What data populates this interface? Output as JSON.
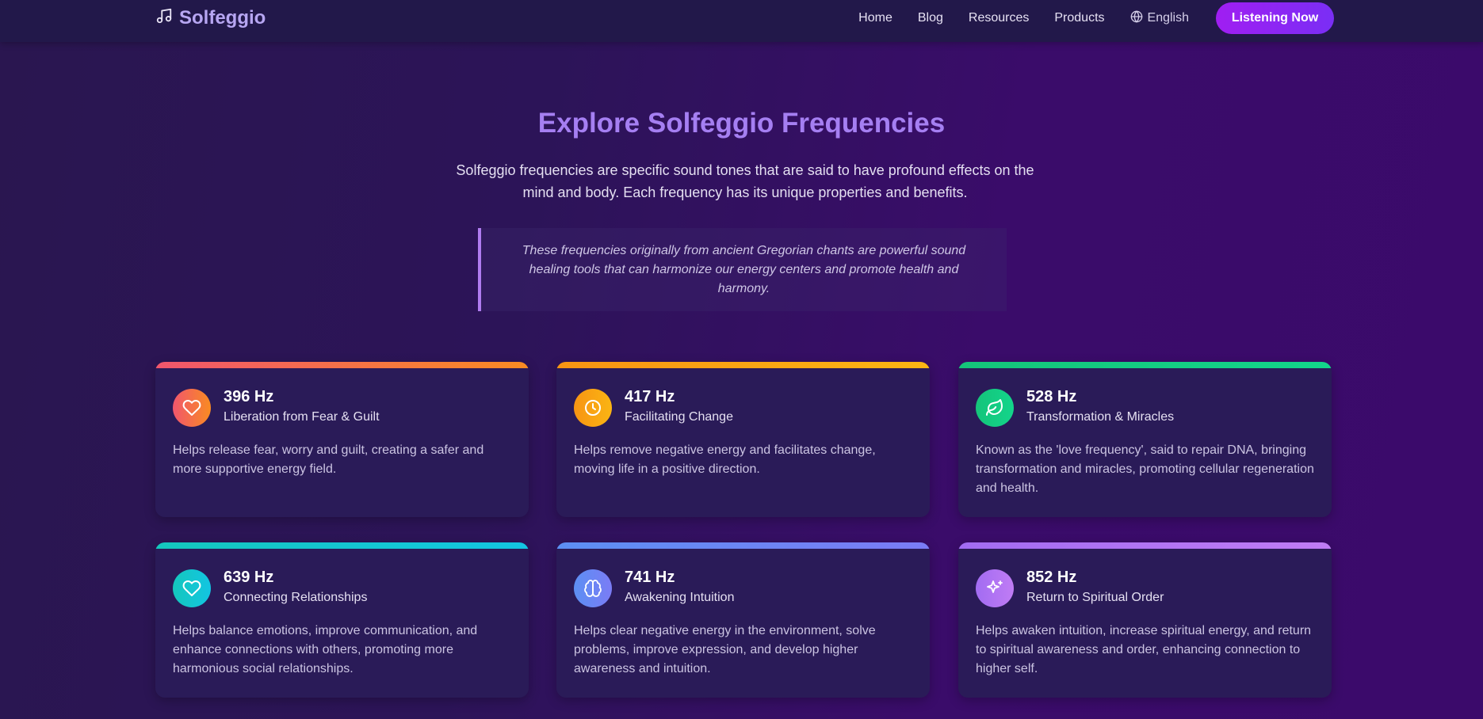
{
  "header": {
    "brand": "Solfeggio",
    "brand_icon": "music-note-icon",
    "nav": [
      "Home",
      "Blog",
      "Resources",
      "Products"
    ],
    "language": "English",
    "language_icon": "globe-icon",
    "cta": "Listening Now"
  },
  "hero": {
    "title": "Explore Solfeggio Frequencies",
    "subtitle": "Solfeggio frequencies are specific sound tones that are said to have profound effects on the mind and body. Each frequency has its unique properties and benefits.",
    "quote": "These frequencies originally from ancient Gregorian chants are powerful sound healing tools that can harmonize our energy centers and promote health and harmony."
  },
  "cards": [
    {
      "hz": "396 Hz",
      "title": "Liberation from Fear & Guilt",
      "desc": "Helps release fear, worry and guilt, creating a safer and more supportive energy field.",
      "icon": "heart-icon",
      "colors": [
        "#f1566d",
        "#f98b22"
      ]
    },
    {
      "hz": "417 Hz",
      "title": "Facilitating Change",
      "desc": "Helps remove negative energy and facilitates change, moving life in a positive direction.",
      "icon": "clock-icon",
      "colors": [
        "#f79413",
        "#fbb513"
      ]
    },
    {
      "hz": "528 Hz",
      "title": "Transformation & Miracles",
      "desc": "Known as the 'love frequency', said to repair DNA, bringing transformation and miracles, promoting cellular regeneration and health.",
      "icon": "leaf-icon",
      "colors": [
        "#15c47a",
        "#13d58b"
      ]
    },
    {
      "hz": "639 Hz",
      "title": "Connecting Relationships",
      "desc": "Helps balance emotions, improve communication, and enhance connections with others, promoting more harmonious social relationships.",
      "icon": "heart-icon",
      "colors": [
        "#14c7bd",
        "#13c5e2"
      ]
    },
    {
      "hz": "741 Hz",
      "title": "Awakening Intuition",
      "desc": "Helps clear negative energy in the environment, solve problems, improve expression, and develop higher awareness and intuition.",
      "icon": "brain-icon",
      "colors": [
        "#5c8ff3",
        "#7b7cf5"
      ]
    },
    {
      "hz": "852 Hz",
      "title": "Return to Spiritual Order",
      "desc": "Helps awaken intuition, increase spiritual energy, and return to spiritual awareness and order, enhancing connection to higher self.",
      "icon": "sparkles-icon",
      "colors": [
        "#a26cf2",
        "#c07cf4"
      ]
    }
  ]
}
